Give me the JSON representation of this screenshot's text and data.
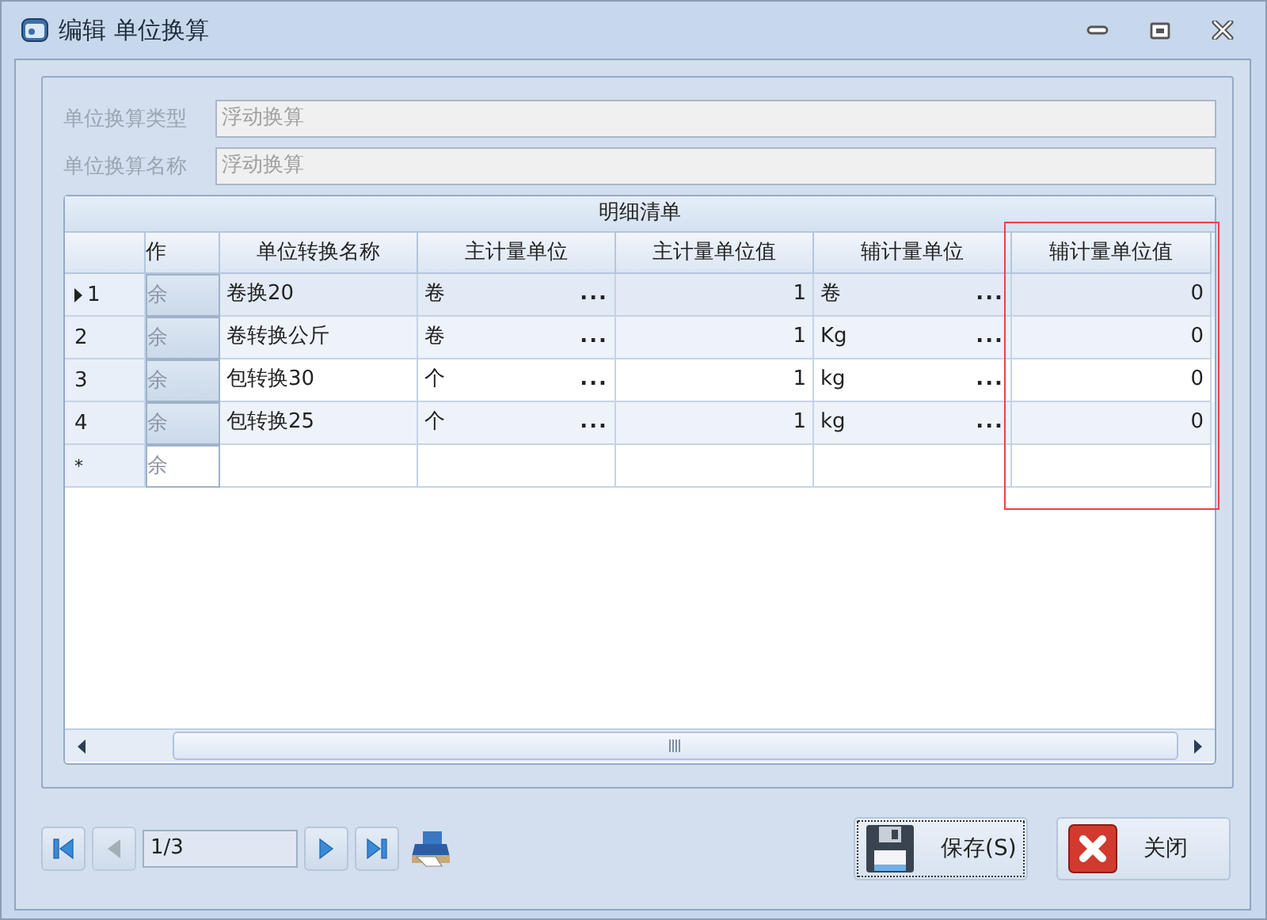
{
  "window": {
    "title": "编辑 单位换算"
  },
  "fields": [
    {
      "label": "单位换算类型",
      "value": "浮动换算",
      "disabled": true
    },
    {
      "label": "单位换算名称",
      "value": "浮动换算",
      "disabled": true
    }
  ],
  "grid": {
    "caption": "明细清单",
    "columns": [
      "作",
      "单位转换名称",
      "主计量单位",
      "主计量单位值",
      "辅计量单位",
      "辅计量单位值"
    ],
    "rows": [
      {
        "indicator": "1",
        "selected": true,
        "action": "余",
        "name": "卷换20",
        "main_unit": "卷",
        "main_value": "1",
        "sub_unit": "卷",
        "sub_value": "0"
      },
      {
        "indicator": "2",
        "selected": false,
        "action": "余",
        "name": "卷转换公斤",
        "main_unit": "卷",
        "main_value": "1",
        "sub_unit": "Kg",
        "sub_value": "0"
      },
      {
        "indicator": "3",
        "selected": false,
        "action": "余",
        "name": "包转换30",
        "main_unit": "个",
        "main_value": "1",
        "sub_unit": "kg",
        "sub_value": "0"
      },
      {
        "indicator": "4",
        "selected": false,
        "action": "余",
        "name": "包转换25",
        "main_unit": "个",
        "main_value": "1",
        "sub_unit": "kg",
        "sub_value": "0"
      }
    ],
    "new_row": {
      "indicator": "*",
      "action": "余"
    },
    "ellipsis": "..."
  },
  "navigator": {
    "page": "1/3",
    "prev_disabled": true
  },
  "buttons": [
    {
      "kind": "save",
      "label": "保存(S)"
    },
    {
      "kind": "close",
      "label": "关闭"
    }
  ]
}
